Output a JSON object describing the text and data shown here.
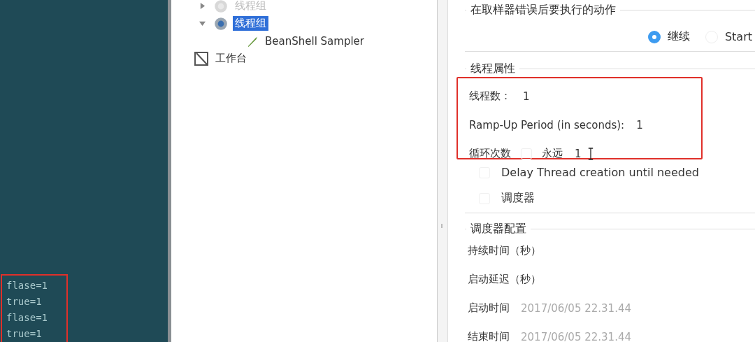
{
  "console": {
    "annotated": true,
    "lines": [
      "flase=1",
      "true=1",
      "flase=1",
      "true=1"
    ]
  },
  "tree": {
    "items": [
      {
        "label": "线程组",
        "kind": "thread-group",
        "expanded": false,
        "selected": false,
        "disabled": true
      },
      {
        "label": "线程组",
        "kind": "thread-group",
        "expanded": true,
        "selected": true,
        "disabled": false,
        "children": [
          {
            "label": "BeanShell Sampler",
            "kind": "sampler",
            "selected": false,
            "disabled": false
          }
        ]
      }
    ],
    "workbench": {
      "label": "工作台",
      "kind": "workbench",
      "selected": false,
      "disabled": false
    }
  },
  "error_action": {
    "title": "在取样器错误后要执行的动作",
    "options": [
      {
        "label": "继续",
        "selected": true
      },
      {
        "label": "Start",
        "selected": false
      }
    ]
  },
  "thread_properties": {
    "title": "线程属性",
    "annotated": true,
    "threads_label": "线程数：",
    "threads_value": "1",
    "rampup_label": "Ramp-Up Period (in seconds):",
    "rampup_value": "1",
    "loop_label": "循环次数",
    "forever": {
      "label": "永远",
      "checked": false
    },
    "loop_value": "1",
    "delay": {
      "label": "Delay Thread creation until needed",
      "checked": false
    },
    "scheduler": {
      "label": "调度器",
      "checked": false
    }
  },
  "scheduler_config": {
    "title": "调度器配置",
    "fields": [
      {
        "label": "持续时间（秒）"
      },
      {
        "label": "启动延迟（秒）"
      },
      {
        "label": "启动时间",
        "value": "2017/06/05 22.31.44"
      },
      {
        "label": "结束时间",
        "value": "2017/06/05 22.31.44"
      }
    ]
  }
}
